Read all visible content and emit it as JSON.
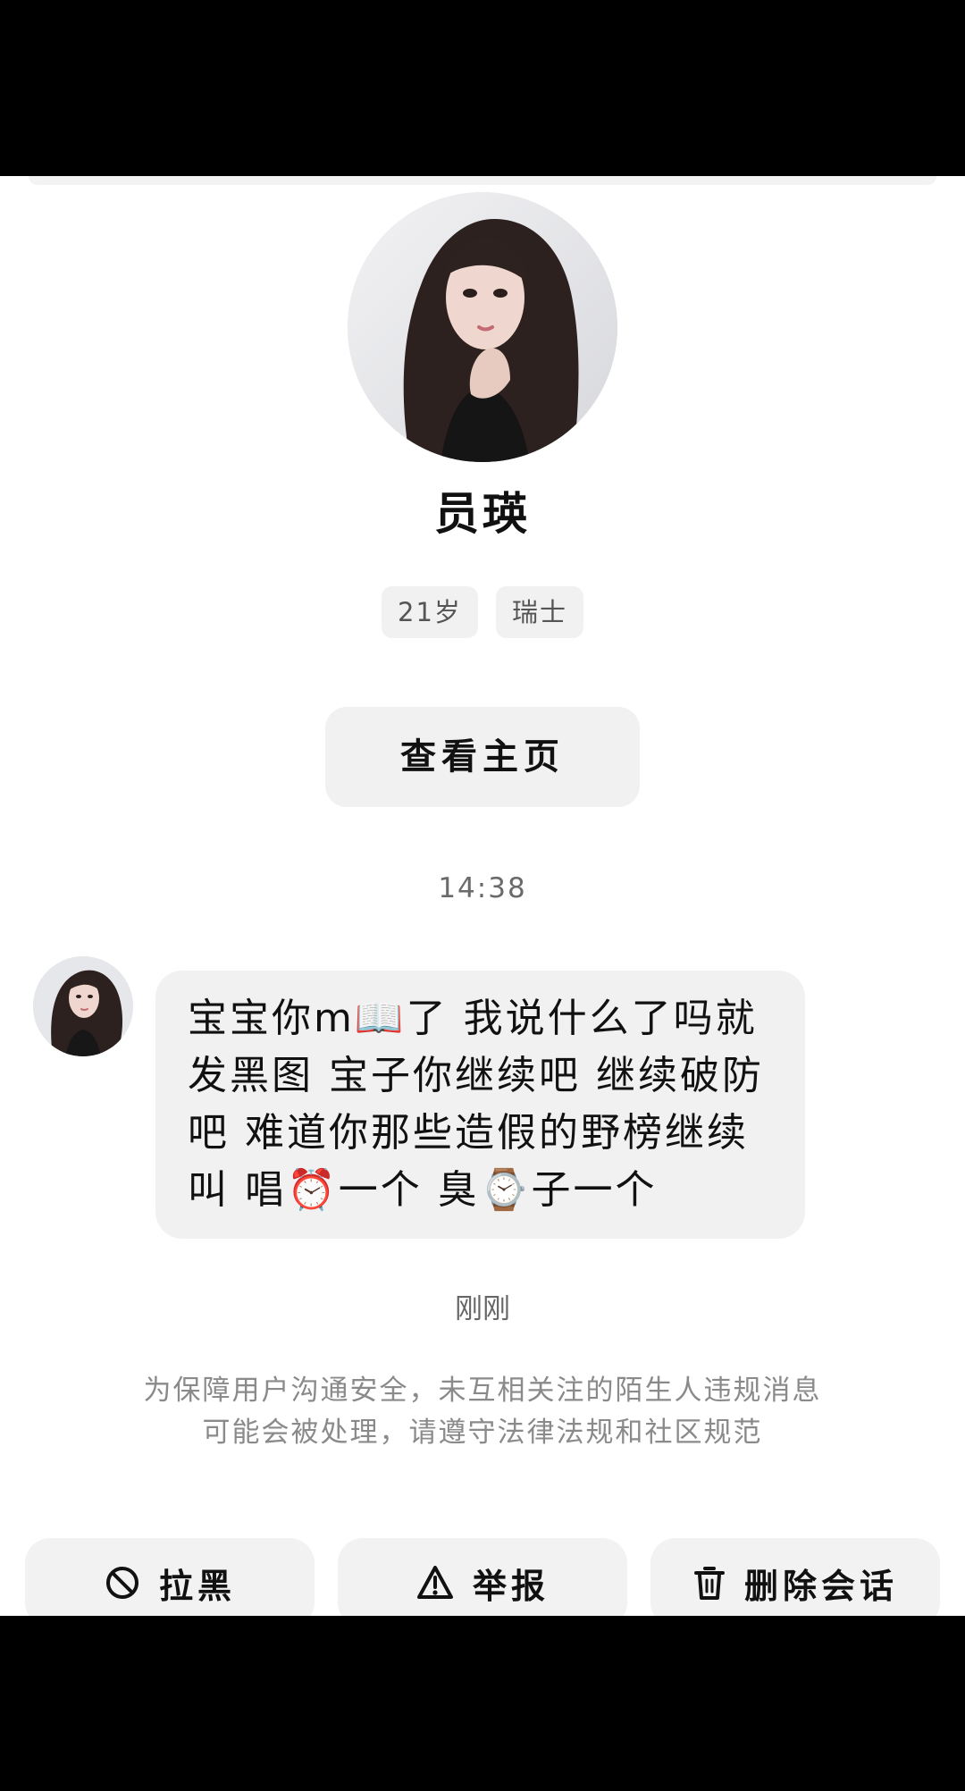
{
  "profile": {
    "name": "员瑛",
    "tags": [
      "21岁",
      "瑞士"
    ],
    "view_profile_label": "查看主页"
  },
  "chat": {
    "timestamp": "14:38",
    "message": "宝宝你m📖了 我说什么了吗就发黑图 宝子你继续吧 继续破防吧 难道你那些造假的野榜继续叫 唱⏰一个 臭⌚子一个",
    "status": "刚刚",
    "safety_notice": "为保障用户沟通安全，未互相关注的陌生人违规消息可能会被处理，请遵守法律法规和社区规范"
  },
  "actions": {
    "block_label": "拉黑",
    "report_label": "举报",
    "delete_label": "删除会话"
  },
  "icons": {
    "block": "block-icon",
    "report": "warning-icon",
    "delete": "trash-icon"
  },
  "colors": {
    "background": "#ffffff",
    "surface": "#f1f1f1",
    "text": "#111111",
    "muted_text": "#8a8a8a"
  }
}
